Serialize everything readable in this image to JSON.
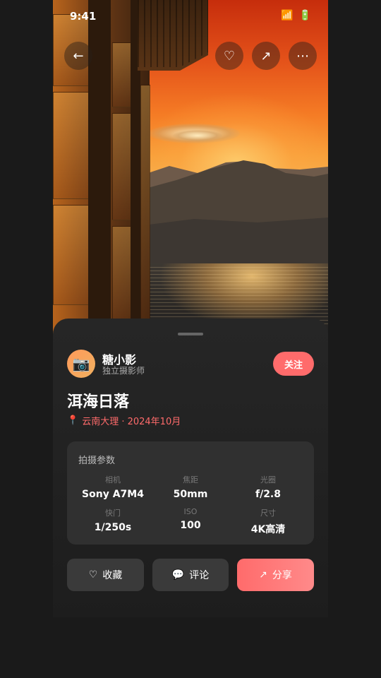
{
  "status_bar": {
    "time": "9:41",
    "signal_icon": "📶",
    "battery_icon": "🔋"
  },
  "top_actions": {
    "back_icon": "←",
    "like_icon": "♡",
    "share_icon": "↗",
    "more_icon": "⋯"
  },
  "author": {
    "avatar_icon": "📷",
    "name": "糖小影",
    "role": "独立摄影师",
    "follow_label": "关注"
  },
  "photo": {
    "title": "洱海日落",
    "location_icon": "📍",
    "location": "云南大理 · 2024年10月"
  },
  "params": {
    "title": "拍摄参数",
    "items": [
      {
        "label": "相机",
        "value": "Sony A7M4"
      },
      {
        "label": "焦距",
        "value": "50mm"
      },
      {
        "label": "光圈",
        "value": "f/2.8"
      },
      {
        "label": "快门",
        "value": "1/250s"
      },
      {
        "label": "ISO",
        "value": "100"
      },
      {
        "label": "尺寸",
        "value": "4K高清"
      }
    ]
  },
  "actions": {
    "favorite": {
      "icon": "♡",
      "label": "收藏"
    },
    "comment": {
      "icon": "💬",
      "label": "评论"
    },
    "share": {
      "icon": "↗",
      "label": "分享"
    }
  },
  "colors": {
    "accent": "#ff6b6b",
    "background": "#1a1a1a",
    "sheet": "#262626",
    "card": "#303030"
  }
}
